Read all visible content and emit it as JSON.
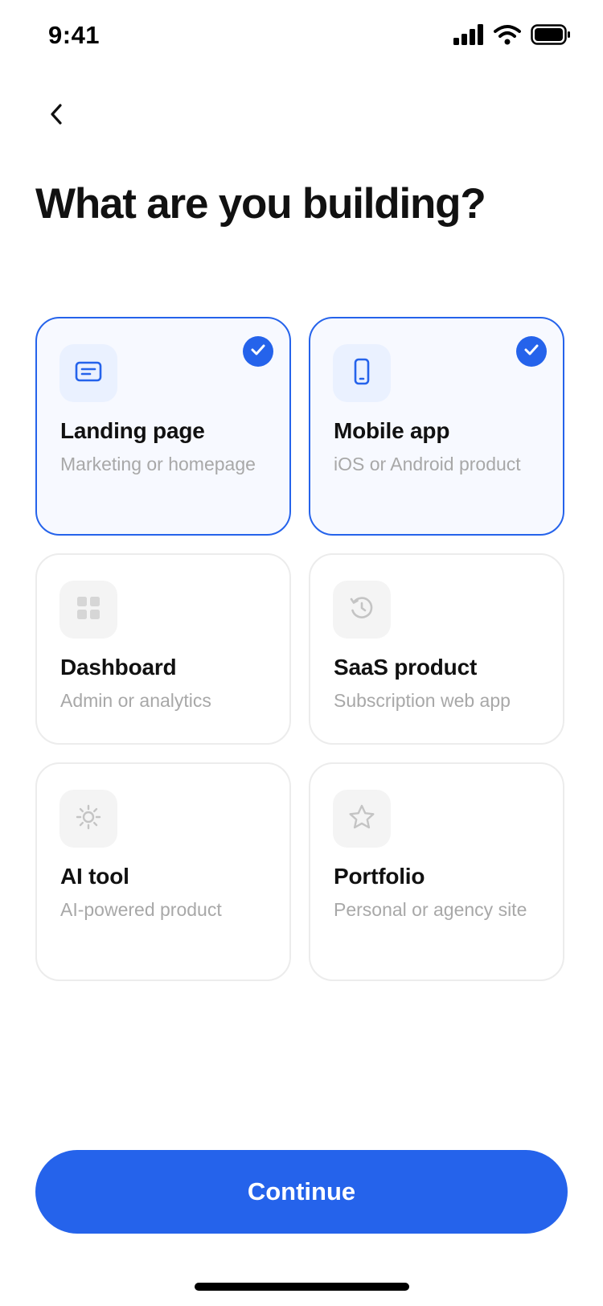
{
  "status_bar": {
    "time": "9:41"
  },
  "header": {
    "title": "What are you building?"
  },
  "options": [
    {
      "title": "Landing page",
      "subtitle": "Marketing or homepage",
      "icon": "landing-page-icon",
      "selected": true
    },
    {
      "title": "Mobile app",
      "subtitle": "iOS or Android product",
      "icon": "mobile-phone-icon",
      "selected": true
    },
    {
      "title": "Dashboard",
      "subtitle": "Admin or analytics",
      "icon": "grid-icon",
      "selected": false
    },
    {
      "title": "SaaS product",
      "subtitle": "Subscription web app",
      "icon": "history-clock-icon",
      "selected": false
    },
    {
      "title": "AI tool",
      "subtitle": "AI-powered product",
      "icon": "sun-icon",
      "selected": false
    },
    {
      "title": "Portfolio",
      "subtitle": "Personal or agency site",
      "icon": "star-icon",
      "selected": false
    }
  ],
  "footer": {
    "continue_label": "Continue"
  },
  "colors": {
    "accent": "#2563eb",
    "selected_bg": "#f7f9ff",
    "border": "#ececec",
    "muted_text": "#a8a8a8"
  }
}
